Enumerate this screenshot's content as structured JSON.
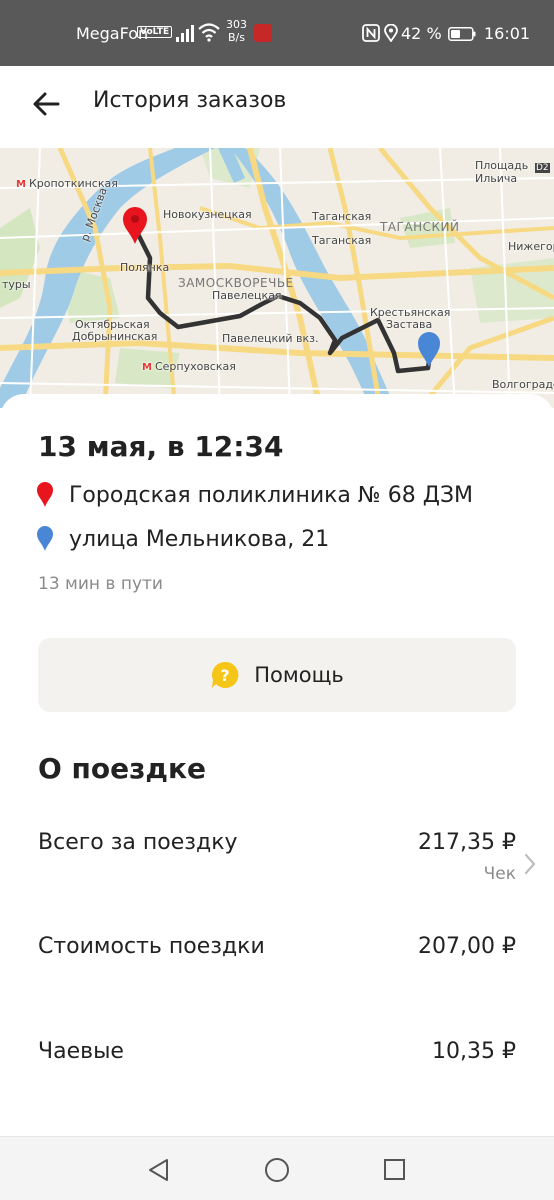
{
  "status_bar": {
    "carrier": "MegaFon",
    "volte": "VoLTE",
    "speed_value": "303",
    "speed_unit": "B/s",
    "battery_percent": "42 %",
    "time": "16:01",
    "icons": [
      "signal-icon",
      "wifi-icon",
      "app-notification-icon",
      "nfc-icon",
      "location-icon",
      "battery-icon"
    ]
  },
  "header": {
    "title": "История заказов",
    "back_icon": "arrow-left-icon"
  },
  "map": {
    "labels": {
      "kropotkinskaya": "Кропоткинская",
      "river_moscow": "р. Москва",
      "novokuznetskaya": "Новокузнецкая",
      "polyanka": "Полянка",
      "zamoskvorechye": "ЗАМОСКВОРЕЧЬЕ",
      "paveletskaya": "Павелецкая",
      "paveletsky_vkz": "Павелецкий вкз.",
      "oktyabrskaya": "Октябрьская",
      "dobryninskaya": "Добрынинская",
      "serpukhovskaya": "Серпуховская",
      "taganskaya1": "Таганская",
      "taganskaya2": "Таганская",
      "tagansky": "ТАГАНСКИЙ",
      "ploshchad": "Площадь",
      "ilyicha": "Ильича",
      "nizhegor": "Нижегор",
      "krestyanskaya": "Крестьянская",
      "zastava": "Застава",
      "volgogradsky": "Волгоградск",
      "tury": "туры",
      "d2": "D2"
    },
    "route_color": "#333333",
    "start_pin_color": "#e8141e",
    "end_pin_color": "#4a86d6"
  },
  "trip": {
    "datetime": "13 мая, в 12:34",
    "from": "Городская поликлиника № 68 ДЗМ",
    "to": "улица Мельникова, 21",
    "duration": "13 мин в пути"
  },
  "help": {
    "label": "Помощь",
    "icon": "question-bubble-icon",
    "icon_color": "#f5c518"
  },
  "about": {
    "title": "О поездке",
    "rows": [
      {
        "label": "Всего за поездку",
        "value": "217,35 ₽",
        "sub": "Чек"
      },
      {
        "label": "Стоимость поездки",
        "value": "207,00 ₽"
      },
      {
        "label": "Чаевые",
        "value": "10,35 ₽"
      }
    ]
  },
  "navbar": {
    "icons": [
      "nav-back-icon",
      "nav-home-icon",
      "nav-recent-icon"
    ]
  }
}
